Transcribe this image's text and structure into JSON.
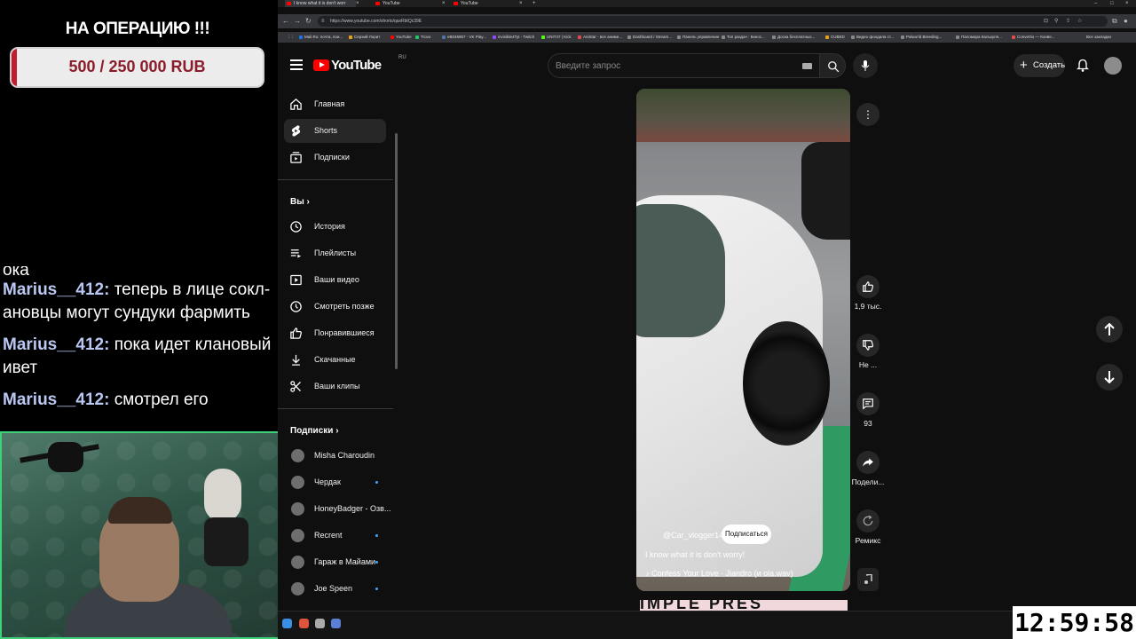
{
  "overlay": {
    "donate_title": "НА ОПЕРАЦИЮ !!!",
    "donate_progress": "500 / 250 000 RUB",
    "donate_fraction": 0.002,
    "chat_partial": "ока",
    "chat": [
      {
        "user": "Marius__412",
        "sep": ":",
        "text": "теперь в лице сокл-ановцы могут сундуки фармить"
      },
      {
        "user": "Marius__412",
        "sep": ":",
        "text": "пока идет клановый ивет"
      },
      {
        "user": "Marius__412",
        "sep": ":",
        "text": "смотрел его"
      }
    ]
  },
  "browser": {
    "tabs": [
      {
        "title": "I know what it is don't worr"
      },
      {
        "title": "YouTube"
      },
      {
        "title": "YouTube"
      }
    ],
    "url": "https://www.youtube.com/shorts/qaxRbtQc39E",
    "bookmarks": [
      "Mail.Ru: почта, пои...",
      "Серхий Лорит",
      "YouTube",
      "Trovo",
      "eB046957 - VK Play...",
      "invisible4Tyt - Twitch",
      "UNIT47 | Kick",
      "AniStar - все аниме...",
      "Dashboard / Stream...",
      "Панель управление",
      "Топ раздач : Кинос...",
      "Доска бесплатных...",
      "CUBED",
      "Видео фондала ст...",
      "Palworld Breeding...",
      "Паломара Калькуля...",
      "Convertio — Конве..."
    ],
    "bookmarks_all": "Все закладки"
  },
  "youtube": {
    "logo": "YouTube",
    "region": "RU",
    "search_placeholder": "Введите запрос",
    "create_label": "Создать",
    "sidebar": {
      "main": [
        "Главная",
        "Shorts",
        "Подписки"
      ],
      "you_header": "Вы",
      "you": [
        "История",
        "Плейлисты",
        "Ваши видео",
        "Смотреть позже",
        "Понравившиеся",
        "Скачанные",
        "Ваши клипы"
      ],
      "subs_header": "Подписки",
      "subs": [
        "Misha Charoudin",
        "Чердак",
        "HoneyBadger - Озв...",
        "Recrent",
        "Гараж в Майами",
        "Joe Speen"
      ]
    },
    "short": {
      "channel": "@Car_vlogger14",
      "subscribe": "Подписаться",
      "title": "I know what it is don't worry!",
      "music": "Confess Your Love · Jiandro (и ola.wav)",
      "next_preview": "IMPLE PRES"
    },
    "actions": {
      "likes": "1,9 тыс.",
      "dislike": "Не ...",
      "comments": "93",
      "share": "Подели...",
      "remix": "Ремикс"
    }
  },
  "clock": "12:59:58",
  "colors": {
    "accent": "#ff0000",
    "link_blue": "#3ea6ff",
    "chat_user": "#b9c7f2",
    "donate_red": "#8b1d2a"
  }
}
